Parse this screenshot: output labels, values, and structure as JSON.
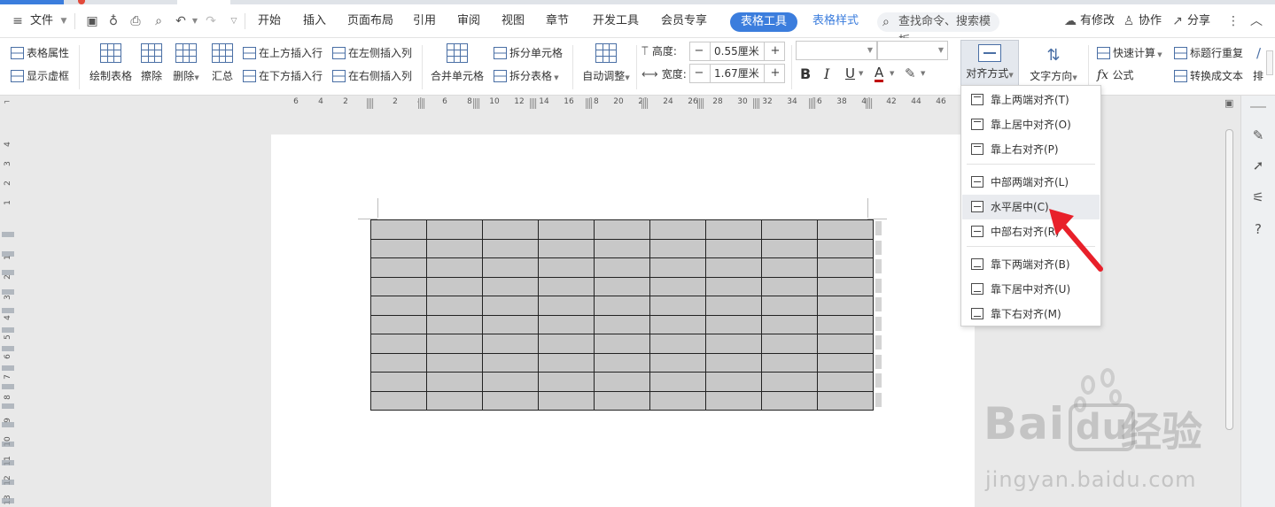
{
  "menubar": {
    "file_label": "文件",
    "tabs": [
      "开始",
      "插入",
      "页面布局",
      "引用",
      "审阅",
      "视图",
      "章节",
      "开发工具",
      "会员专享"
    ],
    "active_tab": "表格工具",
    "style_tab": "表格样式",
    "search_placeholder": "查找命令、搜索模板",
    "modified": "有修改",
    "collaborate": "协作",
    "share": "分享"
  },
  "ribbon": {
    "table_props": "表格属性",
    "show_gridlines": "显示虚框",
    "draw_table": "绘制表格",
    "erase": "擦除",
    "delete": "删除",
    "summary": "汇总",
    "insert_above": "在上方插入行",
    "insert_below": "在下方插入行",
    "insert_left": "在左侧插入列",
    "insert_right": "在右侧插入列",
    "merge_cells": "合并单元格",
    "split_cells": "拆分单元格",
    "split_table": "拆分表格",
    "auto_fit": "自动调整",
    "height_label": "高度:",
    "height_value": "0.55厘米",
    "width_label": "宽度:",
    "width_value": "1.67厘米",
    "bold": "B",
    "italic": "I",
    "underline": "U",
    "font_color": "A",
    "align": "对齐方式",
    "text_direction": "文字方向",
    "quick_calc": "快速计算",
    "formula": "公式",
    "header_repeat": "标题行重复",
    "convert_text": "转换成文本",
    "sort": "排"
  },
  "ruler": {
    "h_ticks": [
      "6",
      "4",
      "2",
      "2",
      "4",
      "6",
      "8",
      "10",
      "12",
      "14",
      "16",
      "18",
      "20",
      "22",
      "24",
      "26",
      "28",
      "30",
      "32",
      "34",
      "36",
      "38",
      "40",
      "42",
      "44",
      "46"
    ],
    "v_ticks": [
      "4",
      "3",
      "2",
      "1",
      "1",
      "2",
      "3",
      "4",
      "5",
      "6",
      "7",
      "8",
      "9",
      "10",
      "11",
      "12",
      "13",
      "14",
      "15"
    ]
  },
  "table": {
    "rows": 10,
    "cols": 9
  },
  "dropdown": {
    "items": [
      {
        "label": "靠上两端对齐(T)",
        "pos": "top"
      },
      {
        "label": "靠上居中对齐(O)",
        "pos": "top"
      },
      {
        "label": "靠上右对齐(P)",
        "pos": "top"
      },
      {
        "label": "中部两端对齐(L)",
        "pos": "mid"
      },
      {
        "label": "水平居中(C)",
        "pos": "mid",
        "highlighted": true
      },
      {
        "label": "中部右对齐(R)",
        "pos": "mid"
      },
      {
        "label": "靠下两端对齐(B)",
        "pos": "bot"
      },
      {
        "label": "靠下居中对齐(U)",
        "pos": "bot"
      },
      {
        "label": "靠下右对齐(M)",
        "pos": "bot"
      }
    ]
  },
  "watermark": {
    "brand": "Bai",
    "brand2": "du",
    "cn": "经验",
    "url": "jingyan.baidu.com"
  },
  "colors": {
    "accent": "#3b7ddd",
    "arrow": "#e8202a",
    "cell": "#c8c8c8"
  }
}
